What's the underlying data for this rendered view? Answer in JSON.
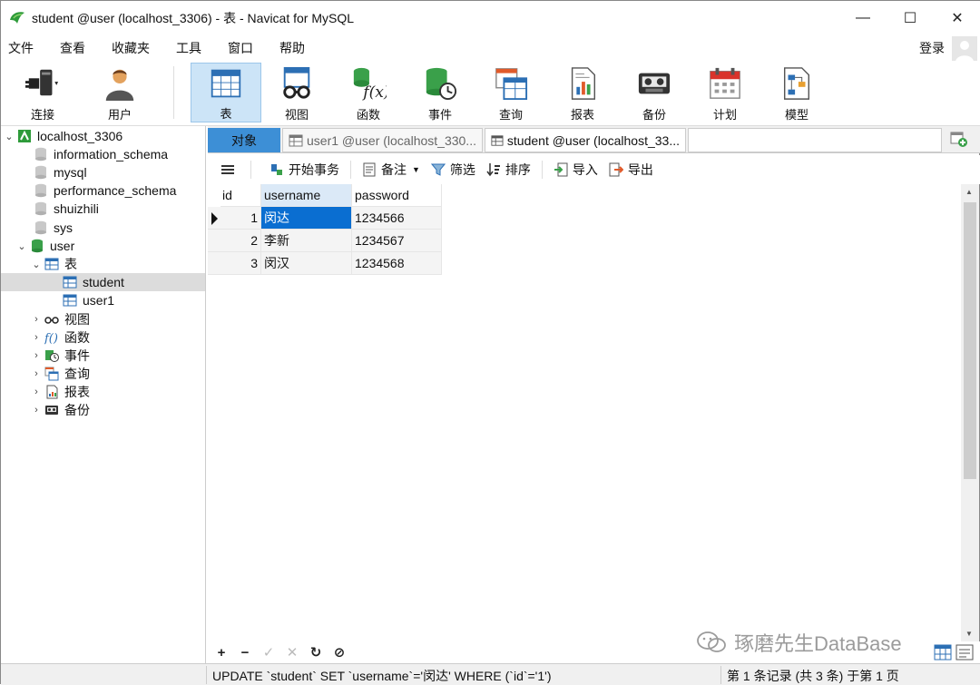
{
  "window": {
    "title": "student @user (localhost_3306) - 表 - Navicat for MySQL",
    "minimize": "—",
    "maximize": "☐",
    "close": "✕"
  },
  "menu": {
    "items": [
      "文件",
      "查看",
      "收藏夹",
      "工具",
      "窗口",
      "帮助"
    ],
    "login": "登录"
  },
  "toolbar": {
    "tools": [
      {
        "label": "连接",
        "icon": "connection-icon"
      },
      {
        "label": "用户",
        "icon": "user-icon"
      },
      {
        "label": "表",
        "icon": "table-icon",
        "active": true
      },
      {
        "label": "视图",
        "icon": "view-icon"
      },
      {
        "label": "函数",
        "icon": "function-icon"
      },
      {
        "label": "事件",
        "icon": "event-icon"
      },
      {
        "label": "查询",
        "icon": "query-icon"
      },
      {
        "label": "报表",
        "icon": "report-icon"
      },
      {
        "label": "备份",
        "icon": "backup-icon"
      },
      {
        "label": "计划",
        "icon": "schedule-icon"
      },
      {
        "label": "模型",
        "icon": "model-icon"
      }
    ]
  },
  "tree": {
    "connection": "localhost_3306",
    "databases": [
      "information_schema",
      "mysql",
      "performance_schema",
      "shuizhili",
      "sys"
    ],
    "open_db": "user",
    "tables_group": "表",
    "tables": [
      "student",
      "user1"
    ],
    "groups": [
      {
        "label": "视图",
        "icon": "view-icon"
      },
      {
        "label": "函数",
        "icon": "function-icon"
      },
      {
        "label": "事件",
        "icon": "event-icon"
      },
      {
        "label": "查询",
        "icon": "query-icon"
      },
      {
        "label": "报表",
        "icon": "report-icon"
      },
      {
        "label": "备份",
        "icon": "backup-icon"
      }
    ]
  },
  "tabs": {
    "objects": "对象",
    "tab1": "user1 @user (localhost_330...",
    "tab2": "student @user (localhost_33..."
  },
  "data_toolbar": {
    "begin_tx": "开始事务",
    "memo": "备注",
    "filter": "筛选",
    "sort": "排序",
    "import": "导入",
    "export": "导出"
  },
  "grid": {
    "columns": [
      "id",
      "username",
      "password"
    ],
    "rows": [
      {
        "id": "1",
        "username": "闵达",
        "password": "1234566"
      },
      {
        "id": "2",
        "username": "李新",
        "password": "1234567"
      },
      {
        "id": "3",
        "username": "闵汉",
        "password": "1234568"
      }
    ]
  },
  "nav": {
    "add": "+",
    "remove": "−",
    "apply": "✓",
    "discard": "✕",
    "refresh": "↻",
    "stop": "⊘"
  },
  "watermark": "琢磨先生DataBase",
  "status": {
    "sql": "UPDATE `student` SET `username`='闵达' WHERE (`id`='1')",
    "records": "第 1 条记录 (共 3 条) 于第 1 页"
  },
  "colors": {
    "selection": "#0a6ed1",
    "tab_active": "#3d8fd6",
    "tool_active": "#cce4f7"
  }
}
